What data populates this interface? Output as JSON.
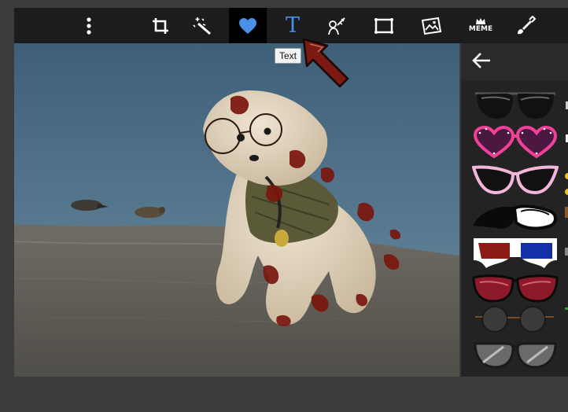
{
  "toolbar": {
    "tools": [
      {
        "id": "more",
        "icon": "vertical-dots-icon"
      },
      {
        "id": "crop",
        "icon": "crop-icon"
      },
      {
        "id": "enhance",
        "icon": "magic-wand-icon"
      },
      {
        "id": "stickers",
        "icon": "heart-icon",
        "active": true
      },
      {
        "id": "text",
        "icon": "text-t-icon",
        "label": "T"
      },
      {
        "id": "draw",
        "icon": "brush-icon"
      },
      {
        "id": "frame",
        "icon": "frame-icon"
      },
      {
        "id": "overlay",
        "icon": "image-overlay-icon"
      },
      {
        "id": "meme",
        "icon": "meme-icon",
        "label": "MEME"
      },
      {
        "id": "paint",
        "icon": "paint-brush-icon"
      }
    ]
  },
  "tooltip": {
    "text": "Text"
  },
  "panel": {
    "back_icon": "back-arrow-icon",
    "stickers": [
      {
        "name": "aviator-sunglasses"
      },
      {
        "name": "pink-heart-glasses"
      },
      {
        "name": "pink-cat-eye-glasses"
      },
      {
        "name": "black-white-wrap-glasses"
      },
      {
        "name": "3d-glasses"
      },
      {
        "name": "red-sport-sunglasses"
      },
      {
        "name": "round-dark-glasses"
      },
      {
        "name": "gray-aviator-glasses"
      }
    ]
  },
  "colors": {
    "accent": "#4a8fe8",
    "toolbar": "#1c1c1c",
    "panel": "#232323",
    "background": "#3b3b3b"
  }
}
